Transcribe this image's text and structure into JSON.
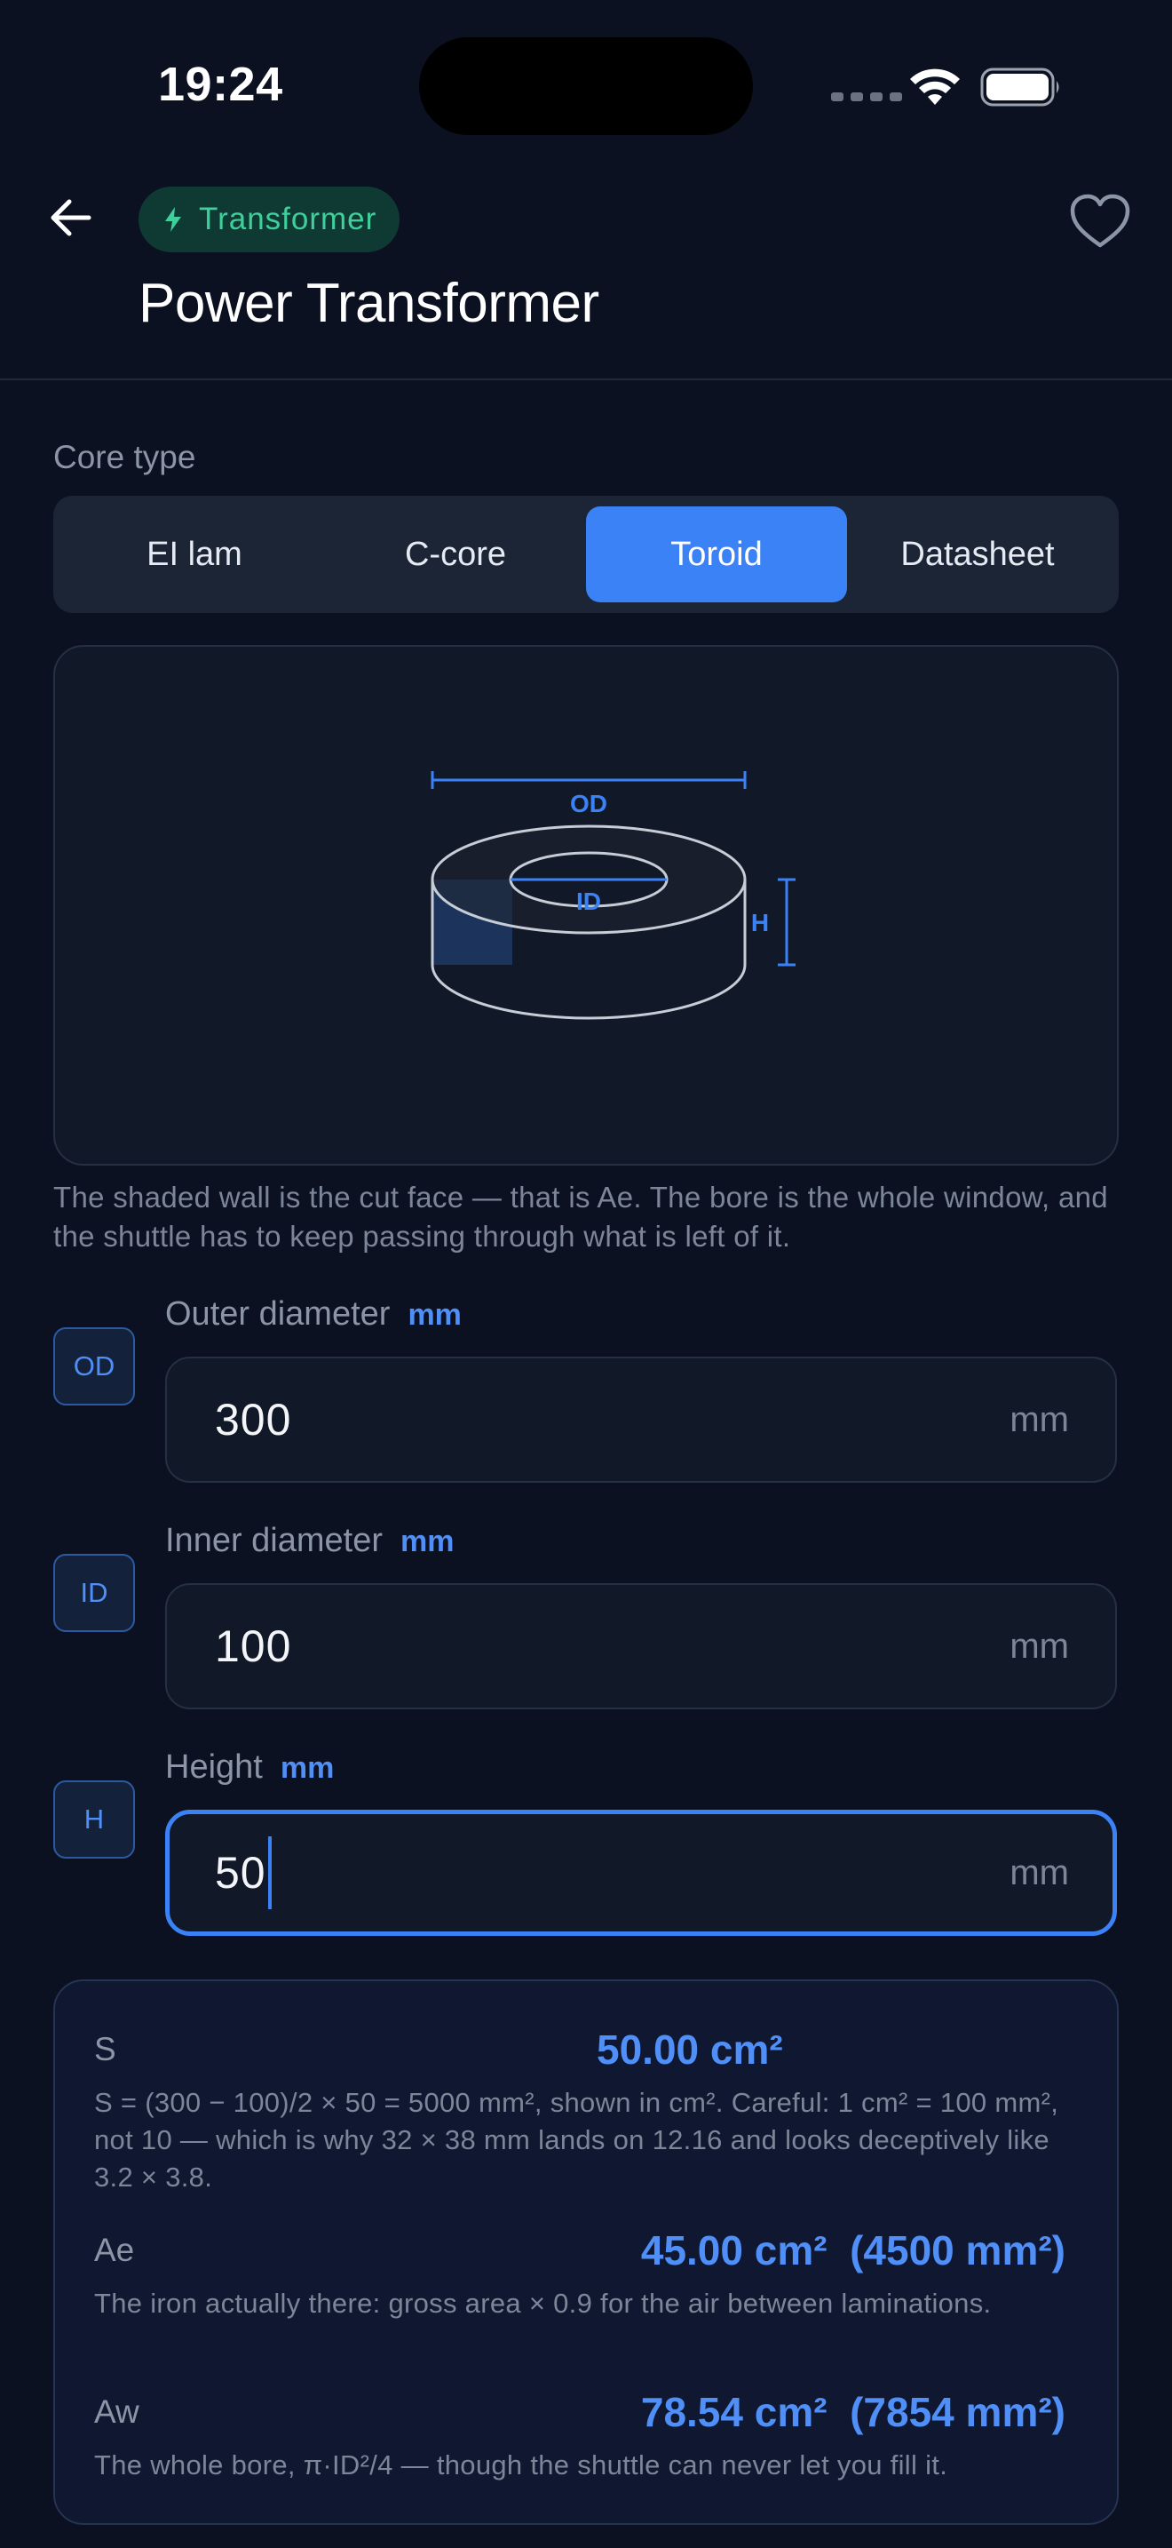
{
  "status_bar": {
    "time": "19:24"
  },
  "header": {
    "category_badge": "Transformer",
    "title": "Power Transformer"
  },
  "core_type": {
    "label": "Core type",
    "options": [
      "EI lam",
      "C-core",
      "Toroid",
      "Datasheet"
    ],
    "selected": "Toroid"
  },
  "diagram": {
    "labels": {
      "od": "OD",
      "id": "ID",
      "h": "H"
    },
    "caption": "The shaded wall is the cut face — that is Ae. The bore is the whole window, and the shuttle has to keep passing through what is left of it."
  },
  "inputs": [
    {
      "chip": "OD",
      "label": "Outer diameter",
      "unit_label": "mm",
      "value": "300",
      "unit": "mm"
    },
    {
      "chip": "ID",
      "label": "Inner diameter",
      "unit_label": "mm",
      "value": "100",
      "unit": "mm"
    },
    {
      "chip": "H",
      "label": "Height",
      "unit_label": "mm",
      "value": "50",
      "unit": "mm"
    }
  ],
  "results": {
    "s": {
      "key": "S",
      "value": "50.00 cm²",
      "note": "S = (300 − 100)/2 × 50 = 5000 mm², shown in cm². Careful: 1 cm² = 100 mm², not 10 — which is why 32 × 38 mm lands on 12.16 and looks deceptively like 3.2 × 3.8."
    },
    "ae": {
      "key": "Ae",
      "value": "45.00 cm²  (4500 mm²)",
      "note": "The iron actually there: gross area × 0.9 for the air between laminations."
    },
    "aw": {
      "key": "Aw",
      "value": "78.54 cm²  (7854 mm²)",
      "note": "The whole bore, π·ID²/4 — though the shuttle can never let you fill it."
    }
  },
  "colors": {
    "background": "#0b1121",
    "accent": "#3b82f6",
    "badge_text": "#3ecf9a",
    "muted_text": "#8b95a5"
  }
}
